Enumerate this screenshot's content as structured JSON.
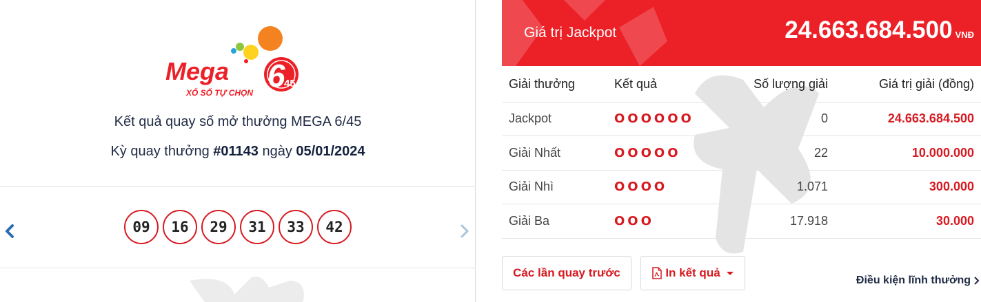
{
  "logo": {
    "brand": "Mega",
    "number_big": "6",
    "number_small": "45",
    "tagline": "XỔ SỐ TỰ CHỌN"
  },
  "draw": {
    "title": "Kết quả quay số mở thưởng MEGA 6/45",
    "prefix": "Kỳ quay thưởng ",
    "number": "#01143",
    "date_prefix": " ngày ",
    "date": "05/01/2024"
  },
  "balls": [
    "09",
    "16",
    "29",
    "31",
    "33",
    "42"
  ],
  "nav": {
    "prev": "‹",
    "next": "›"
  },
  "jackpot": {
    "label": "Giá trị Jackpot",
    "value": "24.663.684.500",
    "currency": "VNĐ"
  },
  "table": {
    "headers": {
      "prize": "Giải thưởng",
      "result": "Kết quả",
      "count": "Số lượng giải",
      "value": "Giá trị giải (đồng)"
    },
    "rows": [
      {
        "prize": "Jackpot",
        "result": "OOOOOO",
        "count": "0",
        "value": "24.663.684.500"
      },
      {
        "prize": "Giải Nhất",
        "result": "OOOOO",
        "count": "22",
        "value": "10.000.000"
      },
      {
        "prize": "Giải Nhì",
        "result": "OOOO",
        "count": "1.071",
        "value": "300.000"
      },
      {
        "prize": "Giải Ba",
        "result": "OOO",
        "count": "17.918",
        "value": "30.000"
      }
    ]
  },
  "buttons": {
    "history": "Các lần quay trước",
    "print": "In kết quả"
  },
  "terms_link": "Điều kiện lĩnh thưởng",
  "colors": {
    "brand_red": "#ec2027",
    "prize_red": "#d71a21",
    "navy_text": "#1f2a44",
    "nav_arrow_blue": "#2b6cb0"
  }
}
